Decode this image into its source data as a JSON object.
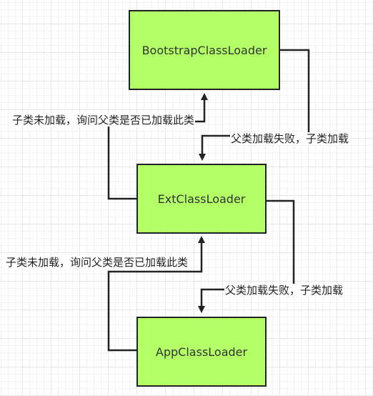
{
  "nodes": {
    "bootstrap": "BootstrapClassLoader",
    "ext": "ExtClassLoader",
    "app": "AppClassLoader"
  },
  "edges": {
    "ext_to_bootstrap_ask": "子类未加载，询问父类是否已加载此类",
    "bootstrap_to_ext_fail": "父类加载失败，子类加载",
    "app_to_ext_ask": "子类未加载，询问父类是否已加载此类",
    "ext_to_app_fail": "父类加载失败，子类加载"
  },
  "colors": {
    "node_fill": "#b3ff66",
    "node_border": "#222222",
    "edge": "#222222"
  }
}
